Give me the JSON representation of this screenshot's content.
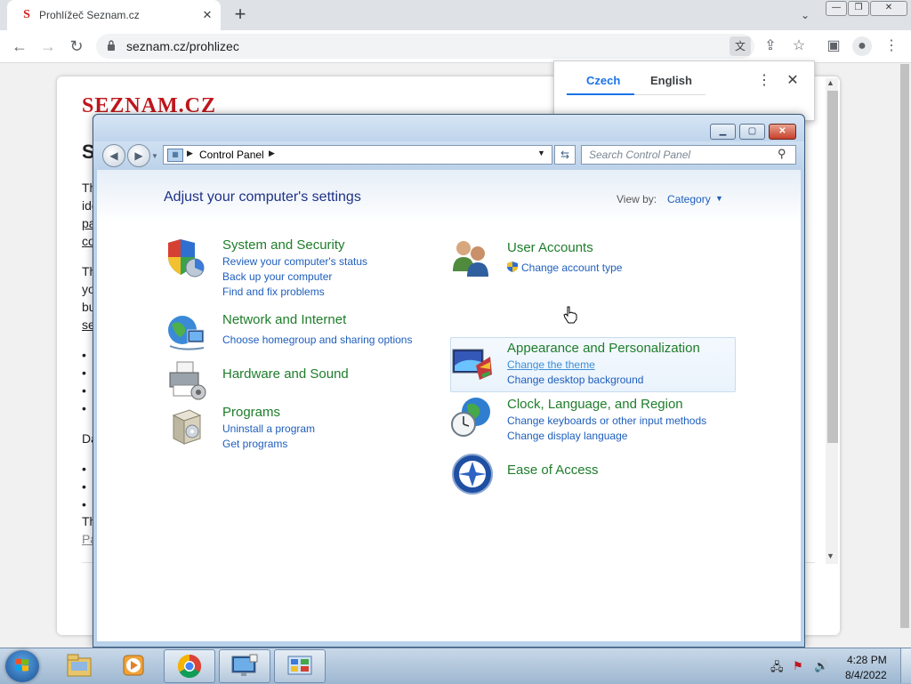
{
  "browser": {
    "tab_title": "Prohlížeč Seznam.cz",
    "tab_favicon": "S",
    "url": "seznam.cz/prohlizec",
    "translate": {
      "tab1": "Czech",
      "tab2": "English"
    }
  },
  "page": {
    "logo": "SEZNAM.CZ",
    "heading_initial": "S",
    "para1": [
      "Th",
      "ide",
      "pa",
      "co"
    ],
    "para2": [
      "Th",
      "yo",
      "bu",
      "se"
    ],
    "bullets1": [
      "•",
      "•",
      "•",
      "•"
    ],
    "para3": "Da",
    "bullets2": [
      "•",
      "•",
      "•"
    ],
    "para4": [
      "Th",
      "Pa"
    ]
  },
  "control_panel": {
    "address": "Control Panel",
    "search_placeholder": "Search Control Panel",
    "heading": "Adjust your computer's settings",
    "view_by_label": "View by:",
    "view_by_value": "Category",
    "categories_left": [
      {
        "title": "System and Security",
        "icon": "shield-icon",
        "links": [
          "Review your computer's status",
          "Back up your computer",
          "Find and fix problems"
        ]
      },
      {
        "title": "Network and Internet",
        "icon": "network-globe-icon",
        "links": [
          "Choose homegroup and sharing options"
        ]
      },
      {
        "title": "Hardware and Sound",
        "icon": "printer-icon",
        "links": []
      },
      {
        "title": "Programs",
        "icon": "programs-box-icon",
        "links": [
          "Uninstall a program",
          "Get programs"
        ]
      }
    ],
    "categories_right": [
      {
        "title": "User Accounts",
        "icon": "users-icon",
        "links": [
          "Change account type"
        ]
      },
      {
        "title": "Appearance and Personalization",
        "icon": "monitor-palette-icon",
        "links": [
          "Change the theme",
          "Change desktop background"
        ]
      },
      {
        "title": "Clock, Language, and Region",
        "icon": "clock-globe-icon",
        "links": [
          "Change keyboards or other input methods",
          "Change display language"
        ]
      },
      {
        "title": "Ease of Access",
        "icon": "ease-of-access-icon",
        "links": []
      }
    ]
  },
  "taskbar": {
    "time": "4:28 PM",
    "date": "8/4/2022",
    "apps": [
      "explorer-icon",
      "media-player-icon",
      "chrome-icon",
      "remote-desktop-icon",
      "control-panel-icon"
    ]
  },
  "colors": {
    "category_title": "#1e7d2b",
    "link": "#1e5ebd",
    "heading": "#1e3287",
    "brand_red": "#c0161c"
  }
}
